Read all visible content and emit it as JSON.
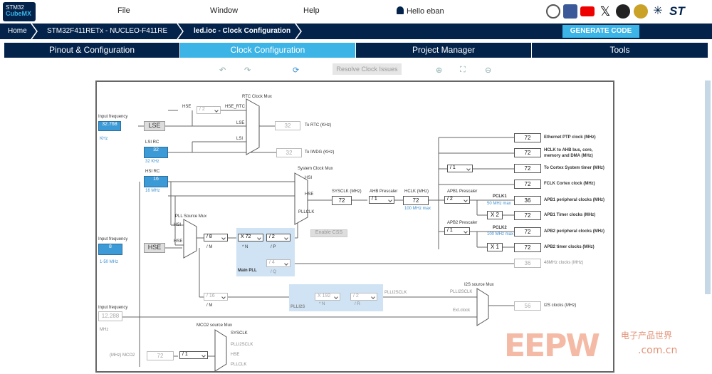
{
  "app": {
    "logo_line1": "STM32",
    "logo_line2": "CubeMX"
  },
  "menu": {
    "file": "File",
    "window": "Window",
    "help": "Help"
  },
  "user": {
    "greeting": "Hello eban"
  },
  "breadcrumb": {
    "home": "Home",
    "board": "STM32F411RETx  -  NUCLEO-F411RE",
    "file": "led.ioc - Clock Configuration"
  },
  "generate_label": "GENERATE CODE",
  "tabs": [
    "Pinout & Configuration",
    "Clock Configuration",
    "Project Manager",
    "Tools"
  ],
  "toolbar": {
    "resolve_label": "Resolve Clock Issues"
  },
  "diagram": {
    "input_freq_label": "Input frequency",
    "lse_value": "32.768",
    "khz": "KHz",
    "lse": "LSE",
    "lsi_rc": "LSI RC",
    "lsi_value": "32",
    "lsi_unit": "32 KHz",
    "hsi_rc": "HSI RC",
    "hsi_value": "16",
    "hsi_unit": "16 MHz",
    "hse_value": "8",
    "hse_range": "1-50 MHz",
    "hse": "HSE",
    "i2s_value": "12.288",
    "mhz": "MHz",
    "rtc_mux": "RTC Clock Mux",
    "hse_div": "/ 2",
    "hse_rtc": "HSE_RTC",
    "lse_small": "LSE",
    "lsi_small": "LSI",
    "rtc_value": "32",
    "to_rtc": "To RTC (KHz)",
    "iwdg_value": "32",
    "to_iwdg": "To IWDG (KHz)",
    "sys_mux": "System Clock Mux",
    "hsi_small": "HSI",
    "hse_small": "HSE",
    "pllclk": "PLLCLK",
    "enable_css": "Enable CSS",
    "pll_mux": "PLL Source Mux",
    "m_div": "/ 8",
    "m_lbl": "/ M",
    "n_mul": "X 72",
    "n_lbl": "* N",
    "p_div": "/ 2",
    "p_lbl": "/ P",
    "q_div": "/ 4",
    "q_lbl": "/ Q",
    "main_pll": "Main PLL",
    "sysclk_lbl": "SYSCLK (MHz)",
    "sysclk": "72",
    "ahb_lbl": "AHB Prescaler",
    "ahb": "/ 1",
    "hclk_lbl": "HCLK (MHz)",
    "hclk": "72",
    "hclk_max": "100 MHz max",
    "apb1_lbl": "APB1 Prescaler",
    "apb1": "/ 2",
    "pclk1": "PCLK1",
    "pclk1_max": "50 MHz max",
    "x2": "X 2",
    "apb2_lbl": "APB2 Prescaler",
    "apb2": "/ 1",
    "pclk2": "PCLK2",
    "pclk2_max": "100 MHz max",
    "x1": "X 1",
    "cortex_div": "/ 1",
    "out_eth": "72",
    "out_eth_lbl": "Ethernet PTP clock (MHz)",
    "out_hclk": "72",
    "out_hclk_lbl": "HCLK to AHB bus, core, memory and DMA (MHz)",
    "out_cortex": "72",
    "out_cortex_lbl": "To Cortex System timer (MHz)",
    "out_fclk": "72",
    "out_fclk_lbl": "FCLK Cortex clock (MHz)",
    "out_apb1p": "36",
    "out_apb1p_lbl": "APB1 peripheral clocks (MHz)",
    "out_apb1t": "72",
    "out_apb1t_lbl": "APB1 Timer clocks (MHz)",
    "out_apb2p": "72",
    "out_apb2p_lbl": "APB2 peripheral clocks (MHz)",
    "out_apb2t": "72",
    "out_apb2t_lbl": "APB2 timer clocks (MHz)",
    "out_48": "36",
    "out_48_lbl": "48MHz clocks (MHz)",
    "i2s_mux": "I2S source Mux",
    "plli2s_m": "/ 16",
    "plli2s_n": "X 192",
    "plli2s_r": "/ 2",
    "n2": "* N",
    "r2": "/ R",
    "plli2s": "PLLI2S",
    "plli2sclk": "PLLI2SCLK",
    "plli2sclk2": "PLLI2SCLK",
    "ext_clock": "Ext.clock",
    "out_i2s": "56",
    "out_i2s_lbl": "I2S clocks (MHz)",
    "mco2_mux": "MCO2 source Mux",
    "mco_sysclk": "SYSCLK",
    "mco_plli2s": "PLLI2SCLK",
    "mco_hse": "HSE",
    "mco_pll": "PLLCLK",
    "mco2_lbl": "(MHz) MCO2",
    "mco2_val": "72",
    "mco2_div": "/ 1"
  },
  "watermark": {
    "text": "EEPW",
    "cn": "电子产品世界",
    "url": ".com.cn"
  }
}
